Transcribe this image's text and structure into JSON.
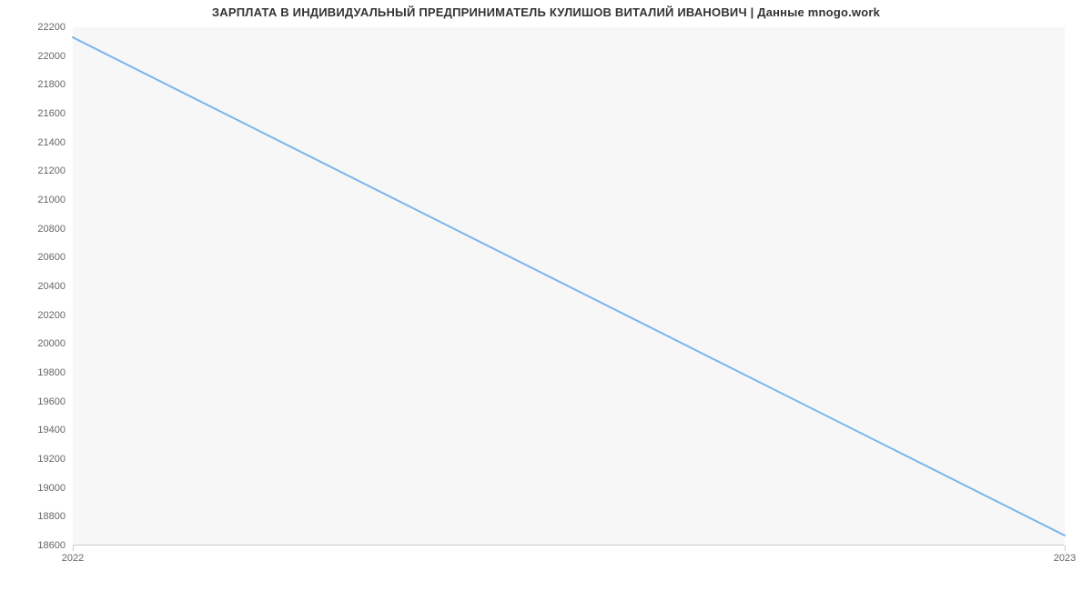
{
  "chart_data": {
    "type": "line",
    "title": "ЗАРПЛАТА В ИНДИВИДУАЛЬНЫЙ ПРЕДПРИНИМАТЕЛЬ КУЛИШОВ ВИТАЛИЙ ИВАНОВИЧ | Данные mnogo.work",
    "x": [
      2022,
      2023
    ],
    "values": [
      22130,
      18670
    ],
    "x_ticks": [
      2022,
      2023
    ],
    "y_ticks": [
      18600,
      18800,
      19000,
      19200,
      19400,
      19600,
      19800,
      20000,
      20200,
      20400,
      20600,
      20800,
      21000,
      21200,
      21400,
      21600,
      21800,
      22000,
      22200
    ],
    "ylim": [
      18600,
      22200
    ],
    "xlabel": "",
    "ylabel": ""
  }
}
